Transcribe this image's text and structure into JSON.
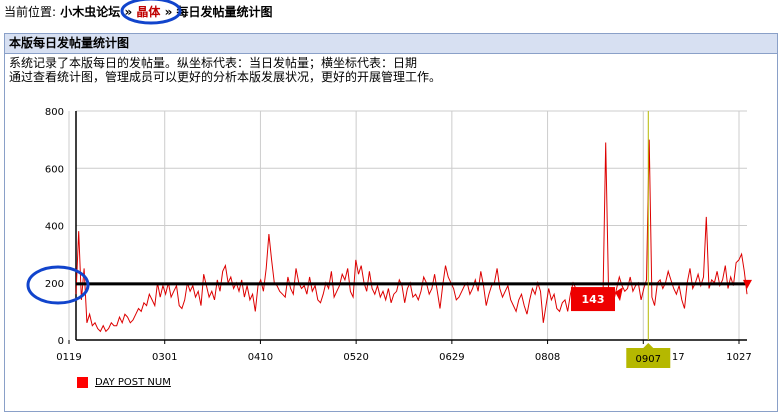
{
  "breadcrumb": {
    "prefix": "当前位置:",
    "forum": "小木虫论坛",
    "sep1": "»",
    "board": "晶体",
    "sep2": "»",
    "page": "每日发帖量统计图"
  },
  "panel": {
    "title": "本版每日发帖量统计图",
    "desc_line1": "系统记录了本版每日的发帖量。纵坐标代表：当日发帖量；横坐标代表：日期",
    "desc_line2": "通过查看统计图，管理成员可以更好的分析本版发展状况，更好的开展管理工作。"
  },
  "colors": {
    "series": "#dd0000",
    "avg_line": "#000000",
    "annotation_circle": "#1144cc",
    "cursor_line": "#b5b800",
    "marker_fill": "#ee0000"
  },
  "chart_data": {
    "type": "line",
    "x_ticks": [
      "0119",
      "0301",
      "0410",
      "0520",
      "0629",
      "0808",
      "0907",
      "1027"
    ],
    "y_ticks": [
      "0",
      "200",
      "400",
      "600",
      "800"
    ],
    "ylim": [
      0,
      800
    ],
    "partial_tick_label": "17",
    "series": [
      {
        "name": "DAY POST NUM",
        "values": [
          160,
          380,
          140,
          250,
          60,
          90,
          50,
          60,
          40,
          30,
          50,
          30,
          40,
          60,
          50,
          50,
          80,
          60,
          90,
          80,
          60,
          70,
          90,
          110,
          100,
          130,
          120,
          160,
          140,
          120,
          200,
          150,
          190,
          160,
          200,
          150,
          170,
          190,
          120,
          110,
          140,
          200,
          170,
          190,
          150,
          170,
          120,
          230,
          190,
          150,
          170,
          140,
          210,
          170,
          240,
          260,
          200,
          220,
          180,
          200,
          170,
          210,
          150,
          190,
          140,
          160,
          100,
          190,
          210,
          170,
          250,
          370,
          280,
          200,
          190,
          170,
          160,
          150,
          220,
          180,
          160,
          250,
          200,
          180,
          190,
          160,
          220,
          170,
          190,
          140,
          130,
          160,
          200,
          180,
          240,
          150,
          170,
          190,
          230,
          210,
          250,
          170,
          150,
          280,
          230,
          260,
          200,
          170,
          240,
          180,
          160,
          190,
          150,
          170,
          140,
          180,
          130,
          160,
          170,
          210,
          190,
          130,
          180,
          200,
          150,
          160,
          140,
          170,
          220,
          200,
          160,
          180,
          230,
          170,
          110,
          190,
          260,
          220,
          200,
          180,
          140,
          150,
          170,
          190,
          200,
          160,
          180,
          210,
          170,
          240,
          190,
          120,
          160,
          190,
          200,
          250,
          180,
          150,
          170,
          190,
          140,
          120,
          100,
          140,
          160,
          120,
          90,
          140,
          180,
          160,
          200,
          170,
          60,
          120,
          180,
          140,
          160,
          110,
          100,
          130,
          140,
          100,
          160,
          200,
          180,
          150,
          120,
          140,
          110,
          150,
          170,
          160,
          140,
          120,
          150,
          690,
          180,
          160,
          140,
          180,
          220,
          190,
          170,
          180,
          220,
          170,
          190,
          200,
          140,
          180,
          210,
          700,
          150,
          120,
          200,
          210,
          180,
          200,
          240,
          210,
          180,
          160,
          190,
          140,
          110,
          200,
          250,
          180,
          200,
          230,
          190,
          220,
          430,
          180,
          210,
          200,
          240,
          190,
          210,
          260,
          180,
          220,
          190,
          270,
          280,
          300,
          240,
          160
        ],
        "total_points": 282
      }
    ],
    "average": 196,
    "highlight": {
      "label": "143",
      "value": 143,
      "x_label": "0907"
    },
    "legend": {
      "label": "DAY POST NUM",
      "placement": "bottom-left"
    }
  }
}
